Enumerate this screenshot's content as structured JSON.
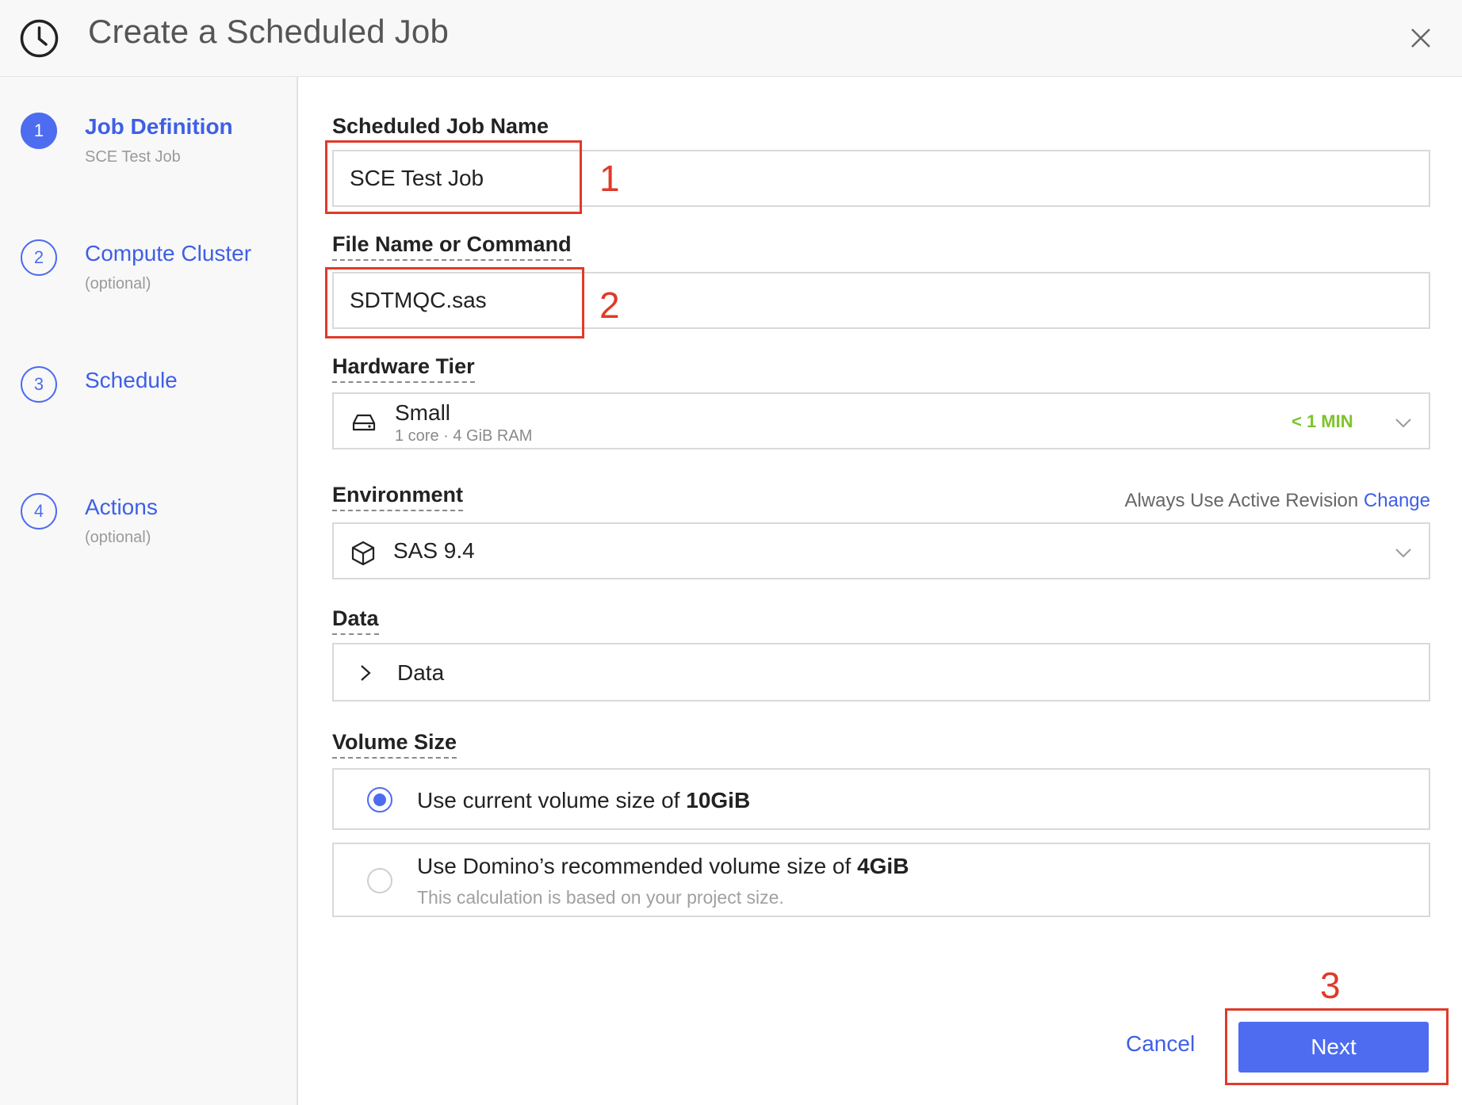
{
  "header": {
    "title": "Create a Scheduled Job"
  },
  "steps": [
    {
      "num": "1",
      "label": "Job Definition",
      "sub": "SCE Test Job"
    },
    {
      "num": "2",
      "label": "Compute Cluster",
      "sub": "(optional)"
    },
    {
      "num": "3",
      "label": "Schedule",
      "sub": ""
    },
    {
      "num": "4",
      "label": "Actions",
      "sub": "(optional)"
    }
  ],
  "form": {
    "job_name_label": "Scheduled Job Name",
    "job_name_value": "SCE Test Job",
    "file_label": "File Name or Command",
    "file_value": "SDTMQC.sas",
    "hardware_label": "Hardware Tier",
    "hardware_name": "Small",
    "hardware_specs": "1 core · 4 GiB RAM",
    "hardware_wait": "< 1 MIN",
    "environment_label": "Environment",
    "environment_revision_text": "Always Use Active Revision",
    "environment_change_link": "Change",
    "environment_value": "SAS 9.4",
    "data_label": "Data",
    "data_toggle": "Data",
    "volume_label": "Volume Size",
    "volume_option1_text": "Use current volume size of ",
    "volume_option1_size": "10GiB",
    "volume_option2_text": "Use Domino’s recommended volume size of ",
    "volume_option2_size": "4GiB",
    "volume_option2_note": "This calculation is based on your project size."
  },
  "footer": {
    "cancel": "Cancel",
    "next": "Next"
  },
  "annotations": [
    "1",
    "2",
    "3"
  ],
  "colors": {
    "accent": "#4d6cf0",
    "annotation": "#e03a2a",
    "wait_green": "#7cc32a"
  }
}
